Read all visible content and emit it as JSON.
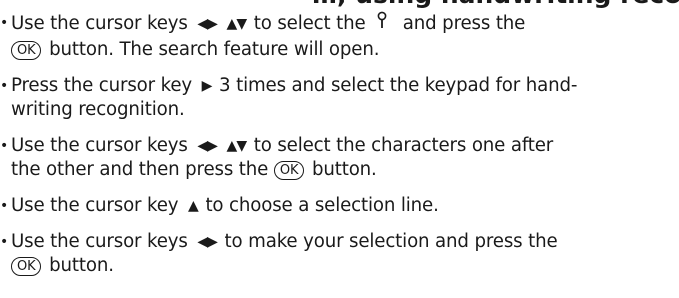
{
  "heading_fragment": "…, using handwriting recognition",
  "ok_label": "OK",
  "icons": {
    "left_right_keys": "◀▶",
    "up_down_keys": "▲▼",
    "right_key": "▶",
    "up_key": "▲",
    "search_icon": "search-icon"
  },
  "steps": [
    {
      "l1a": "Use the cursor keys",
      "l1b": "to select the",
      "l1c": "and press the",
      "l2b": "button. The search feature will open."
    },
    {
      "l1a": "Press the cursor key",
      "l1b": "3 times and select the keypad for hand-",
      "l2": "writing recognition."
    },
    {
      "l1a": "Use the cursor keys",
      "l1b": "to select the characters one after",
      "l2a": "the other and then press the",
      "l2b": "button."
    },
    {
      "l1a": "Use the cursor key",
      "l1b": "to choose a selection line."
    },
    {
      "l1a": "Use the cursor keys",
      "l1b": "to make your selection and press the",
      "l2b": "button."
    }
  ]
}
